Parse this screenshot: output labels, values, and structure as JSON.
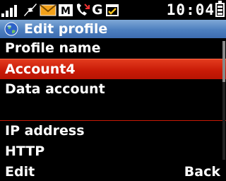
{
  "status": {
    "time": "10:04",
    "icons": [
      "signal-icon",
      "data-transfer-icon",
      "message-envelope-icon",
      "mms-icon",
      "missed-call-icon",
      "gprs-icon",
      "calendar-icon",
      "battery-icon"
    ],
    "gprs_label": "G",
    "mms_label": "M"
  },
  "header": {
    "title": "Edit profile",
    "icon": "globe-icon"
  },
  "list": {
    "items": [
      {
        "label": "Profile name"
      },
      {
        "label": "Account4",
        "selected": true
      },
      {
        "label": "Data account"
      },
      {
        "label": ""
      },
      {
        "label": "IP address"
      },
      {
        "label": "HTTP"
      }
    ]
  },
  "softkeys": {
    "left": "Edit",
    "right": "Back"
  },
  "colors": {
    "selection": "#c81a06",
    "title_bar": "#4d7fbf",
    "background": "#000000",
    "text": "#ffffff"
  }
}
